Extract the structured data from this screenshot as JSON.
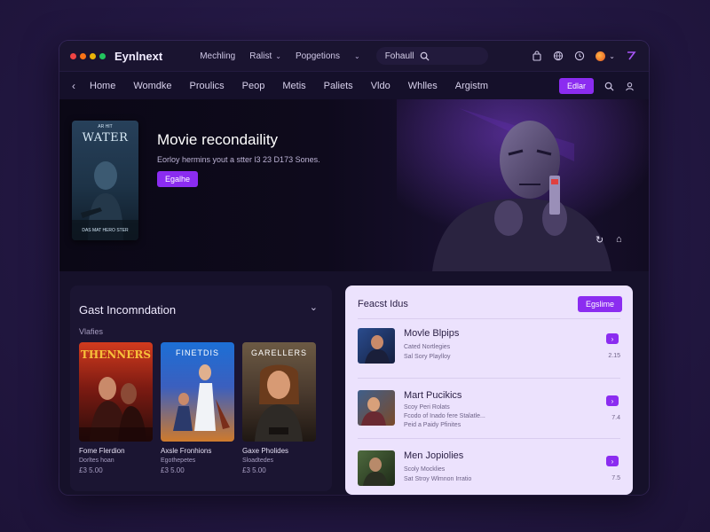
{
  "app": {
    "name": "Eynlnext",
    "dots": [
      "#ef4444",
      "#f97316",
      "#eab308",
      "#22c55e"
    ]
  },
  "top_menu": [
    {
      "label": "Mechling",
      "chevron": false
    },
    {
      "label": "Ralist",
      "chevron": true
    },
    {
      "label": "Popgetions",
      "chevron": false
    },
    {
      "label": "",
      "chevron": true
    }
  ],
  "search": {
    "label": "Fohaull"
  },
  "nav": {
    "items": [
      "Home",
      "Womdke",
      "Proulics",
      "Peop",
      "Metis",
      "Paliets",
      "Vldo",
      "Whlles",
      "Argistm"
    ],
    "button": "Edlar"
  },
  "hero": {
    "poster": {
      "tag": "AR HIT",
      "title": "WATER",
      "footer": "DAS MAT HERO STER"
    },
    "title": "Movie recondaility",
    "subtitle": "Eorloy hermins yout a stter l3 23 D173 Sones.",
    "button": "Egalhe"
  },
  "left_panel": {
    "title": "Gast Incomndation",
    "subtitle": "Vlafies",
    "cards": [
      {
        "poster_title": "THENNERS",
        "title": "Fome Flerdion",
        "meta": "Dorltes hoan",
        "price": "£3 5.00"
      },
      {
        "poster_title": "FINETDIS",
        "title": "Axsle Fronhions",
        "meta": "Egothepetes",
        "price": "£3 5.00"
      },
      {
        "poster_title": "GARELLERS",
        "title": "Gaxe Pholides",
        "meta": "Sloadtedes",
        "price": "£3 5.00"
      }
    ]
  },
  "right_panel": {
    "title": "Feacst Idus",
    "button": "Egslime",
    "rows": [
      {
        "title": "Movle Blpips",
        "lines": [
          "Cated Nortlegies",
          "Sal Sory Playlloy"
        ],
        "number": "2.15"
      },
      {
        "title": "Mart Pucikics",
        "lines": [
          "Scoy Peri Rolats",
          "Fcodo of Inado fere Stalatle...",
          "Peid a Paidy Pfinites"
        ],
        "number": "7.4"
      },
      {
        "title": "Men Jopiolies",
        "lines": [
          "Scoly Mocklies",
          "Sat Stroy Wlmnon Irratio"
        ],
        "number": "7.5"
      }
    ]
  }
}
